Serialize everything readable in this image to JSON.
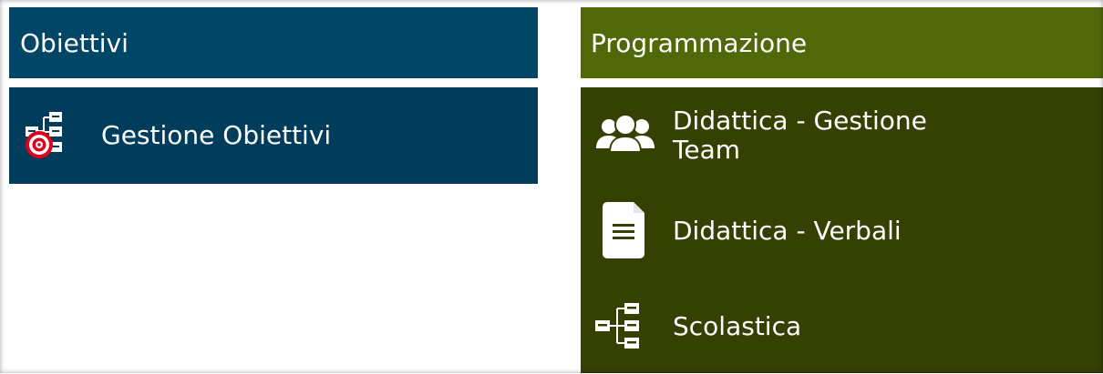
{
  "objectives": {
    "header": "Obiettivi",
    "items": [
      {
        "label": "Gestione Obiettivi",
        "icon": "target-tree-icon"
      }
    ]
  },
  "programming": {
    "header": "Programmazione",
    "items": [
      {
        "label": "Didattica - Gestione Team",
        "icon": "users-icon"
      },
      {
        "label": "Didattica - Verbali",
        "icon": "document-icon"
      },
      {
        "label": "Scolastica",
        "icon": "tree-structure-icon"
      }
    ]
  },
  "colors": {
    "objectives_header": "#004666",
    "objectives_tile": "#003d5c",
    "programming_header": "#506808",
    "programming_tile": "#354003",
    "target_red": "#e0001b"
  }
}
